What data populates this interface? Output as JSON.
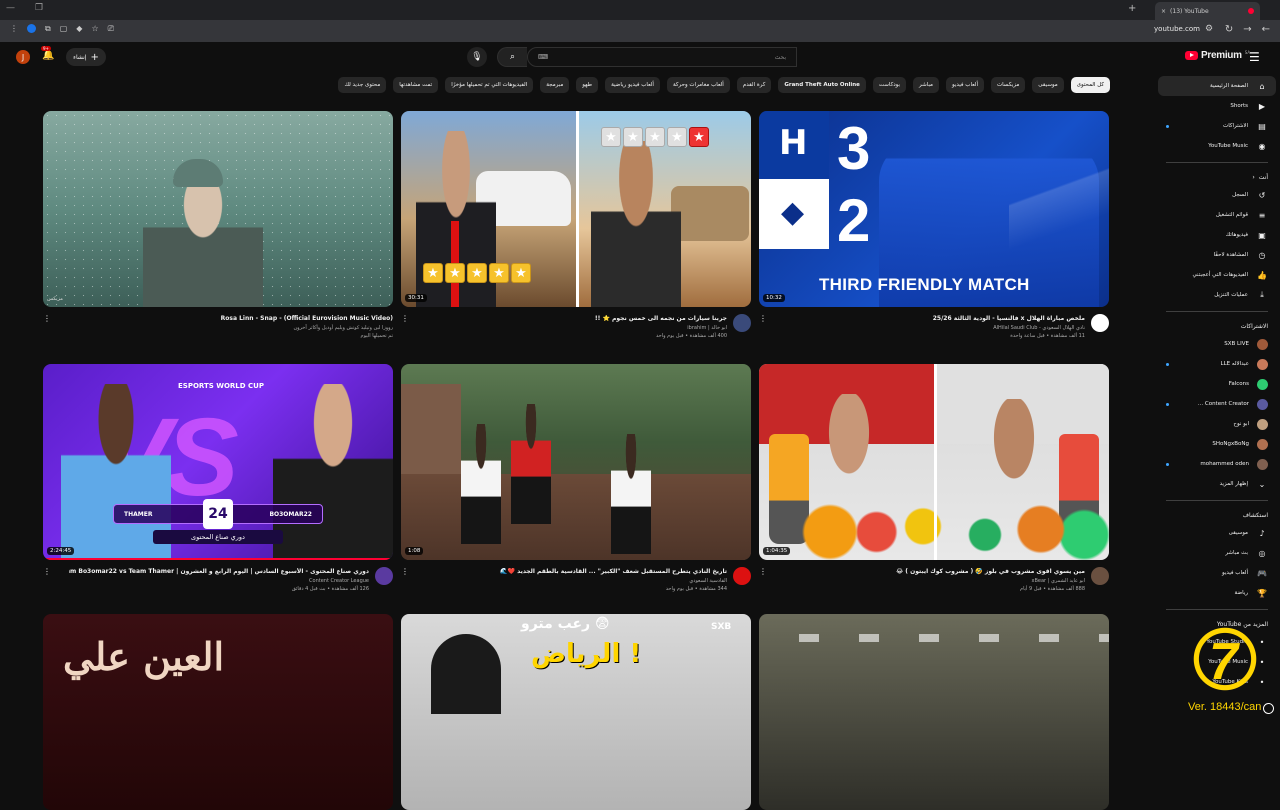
{
  "browser": {
    "tab_title": "(13) YouTube",
    "url": "youtube.com"
  },
  "header": {
    "logo_text": "Premium",
    "country_code": "SA",
    "search_placeholder": "بحث",
    "create_label": "إنشاء",
    "notification_count": "9+",
    "avatar_letter": "J"
  },
  "chips": [
    {
      "label": "كل المحتوى",
      "active": true
    },
    {
      "label": "موسيقى"
    },
    {
      "label": "مزيكسات"
    },
    {
      "label": "ألعاب فيديو"
    },
    {
      "label": "مباشر"
    },
    {
      "label": "بودكاست"
    },
    {
      "label": "Grand Theft Auto Online",
      "bold": true
    },
    {
      "label": "كرة القدم"
    },
    {
      "label": "ألعاب مغامرات وحركة"
    },
    {
      "label": "ألعاب فيديو رياضية"
    },
    {
      "label": "طهو"
    },
    {
      "label": "مبرمجة"
    },
    {
      "label": "الفيديوهات التي تم تحميلها مؤخرًا"
    },
    {
      "label": "تمت مشاهدتها"
    },
    {
      "label": "محتوى جديد لك"
    }
  ],
  "sidebar": {
    "main": [
      {
        "label": "الصفحة الرئيسية",
        "icon": "home-icon",
        "active": true
      },
      {
        "label": "Shorts",
        "icon": "shorts-icon"
      },
      {
        "label": "الاشتراكات",
        "icon": "subscriptions-icon",
        "dot": true
      },
      {
        "label": "YouTube Music",
        "icon": "music-icon"
      }
    ],
    "you_label": "أنت",
    "you": [
      {
        "label": "السجل",
        "icon": "history-icon"
      },
      {
        "label": "قوائم التشغيل",
        "icon": "playlist-icon"
      },
      {
        "label": "فيديوهاتك",
        "icon": "your-videos-icon"
      },
      {
        "label": "المشاهدة لاحقًا",
        "icon": "clock-icon"
      },
      {
        "label": "الفيديوهات التي أعجبتني",
        "icon": "like-icon"
      },
      {
        "label": "عمليات التنزيل",
        "icon": "download-icon"
      }
    ],
    "subs_label": "الاشتراكات",
    "subs": [
      {
        "label": "SXB LIVE",
        "color": "#a05a3a"
      },
      {
        "label": "عبدالاله LLE",
        "color": "#c97a5a",
        "dot": true
      },
      {
        "label": "Falcons",
        "color": "#2ecc71"
      },
      {
        "label": "Content Creator ...",
        "color": "#5a5aa0",
        "dot": true
      },
      {
        "label": "ابو نوح",
        "color": "#c0a080"
      },
      {
        "label": "SHoNgxBoNg",
        "color": "#b07050"
      },
      {
        "label": "mohammed oden",
        "color": "#806050",
        "dot": true
      },
      {
        "label": "إظهار المزيد",
        "icon": "chevron-down-icon"
      }
    ],
    "explore_label": "استكشاف",
    "explore": [
      {
        "label": "موسيقى",
        "icon": "music-note-icon"
      },
      {
        "label": "بث مباشر",
        "icon": "live-icon"
      },
      {
        "label": "ألعاب فيديو",
        "icon": "gaming-icon"
      },
      {
        "label": "رياضة",
        "icon": "trophy-icon"
      }
    ],
    "more_label": "المزيد من YouTube",
    "more": [
      {
        "label": "YouTube Studio"
      },
      {
        "label": "YouTube Music"
      },
      {
        "label": "YouTube Kids"
      }
    ]
  },
  "videos": [
    {
      "title": "Rosa Linn - Snap - (Official Eurovision Music Video)",
      "channel": "رووزا لين وتيليذ كوتش ويليم أوديل وأكاثر آخرون",
      "meta": "تم تحميلها اليوم",
      "duration": "",
      "tag": "مزيكس"
    },
    {
      "title": "جربنا سيارات من نجمه الى خمس نجوم ⭐ !!",
      "channel": "ابو خالد | ibrahim",
      "meta": "400 ألف مشاهدة • قبل يوم واحد",
      "duration": "30:31"
    },
    {
      "title": "ملخص مباراة الهلال x فالنسيا - الودية الثالثة 25/26",
      "channel": "نادي الهلال السعودي - AlHilal Saudi Club",
      "meta": "11 ألف مشاهدة • قبل ساعة واحدة",
      "duration": "10:32"
    },
    {
      "title": "دوري صناع المحتوى - الأسبوع السادس | اليوم الرابع و العشرون | Team Bo3omar22 vs Team Thamer",
      "channel": "Content Creator League",
      "meta": "126 ألف مشاهدة • بث قبل 4 دقائق",
      "duration": "2:24:45"
    },
    {
      "title": "تاريخ النادي يتطرح المستقبل شعف \"الكبير\" ... القادسية بالطقم الجديد ❤️🌊",
      "channel": "القادسية السعودي",
      "meta": "344 مشاهدة • قبل يوم واحد",
      "duration": "1:08"
    },
    {
      "title": "مين يسوي اقوى مشروب في بلوز 🤣 ( مشروب كوك ايبتون ) 😂",
      "channel": "ابو عايد الشمري | xBear",
      "meta": "888 ألف مشاهدة • قبل 9 أيام",
      "duration": "1:04:35"
    },
    {
      "title": "",
      "channel": "",
      "meta": "",
      "duration": "",
      "thumb_text": "العين علي"
    },
    {
      "title": "",
      "channel": "",
      "meta": "",
      "duration": "",
      "thumb_text": "الرياض !",
      "thumb_top": "رعب مترو 😨"
    },
    {
      "title": "",
      "channel": "",
      "meta": "",
      "duration": ""
    }
  ],
  "thumb_texts": {
    "t3_caption": "THIRD FRIENDLY MATCH",
    "t3_score_top": "3",
    "t3_score_bottom": "2",
    "t4_header": "ESPORTS WORLD CUP",
    "t4_vs": "VS",
    "t4_left": "THAMER",
    "t4_right": "BO3OMAR22",
    "t4_day": "24",
    "t4_league": "دوري صناع المحتوى",
    "t8_brand": "SXB"
  },
  "watermark": {
    "version": "Ver. 18443/can"
  }
}
